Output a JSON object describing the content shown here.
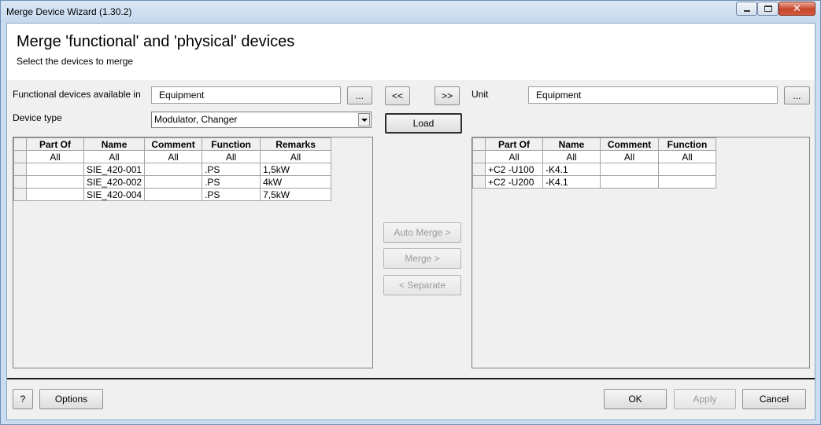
{
  "window": {
    "title": "Merge Device Wizard (1.30.2)",
    "close_glyph": "✕"
  },
  "header": {
    "title": "Merge 'functional' and 'physical' devices",
    "subtitle": "Select the devices to merge"
  },
  "left": {
    "functional_label": "Functional devices available in",
    "functional_value": "Equipment",
    "browse_label": "...",
    "device_type_label": "Device type",
    "device_type_value": "Modulator, Changer",
    "columns": [
      "Part Of",
      "Name",
      "Comment",
      "Function",
      "Remarks"
    ],
    "filter": [
      "All",
      "All",
      "All",
      "All",
      "All"
    ],
    "rows": [
      [
        "",
        "SIE_420-001",
        "",
        ".PS",
        "1,5kW"
      ],
      [
        "",
        "SIE_420-002",
        "",
        ".PS",
        "4kW"
      ],
      [
        "",
        "SIE_420-004",
        "",
        ".PS",
        "7,5kW"
      ]
    ]
  },
  "middle": {
    "prev_label": "<<",
    "next_label": ">>",
    "load_label": "Load",
    "auto_merge_label": "Auto Merge >",
    "merge_label": "Merge >",
    "separate_label": "< Separate"
  },
  "right": {
    "unit_label": "Unit",
    "unit_value": "Equipment",
    "browse_label": "...",
    "columns": [
      "Part Of",
      "Name",
      "Comment",
      "Function"
    ],
    "filter": [
      "All",
      "All",
      "All",
      "All"
    ],
    "rows": [
      [
        "+C2 -U100",
        "-K4.1",
        "",
        ""
      ],
      [
        "+C2 -U200",
        "-K4.1",
        "",
        ""
      ]
    ]
  },
  "footer": {
    "help_label": "?",
    "options_label": "Options",
    "ok_label": "OK",
    "apply_label": "Apply",
    "cancel_label": "Cancel"
  }
}
